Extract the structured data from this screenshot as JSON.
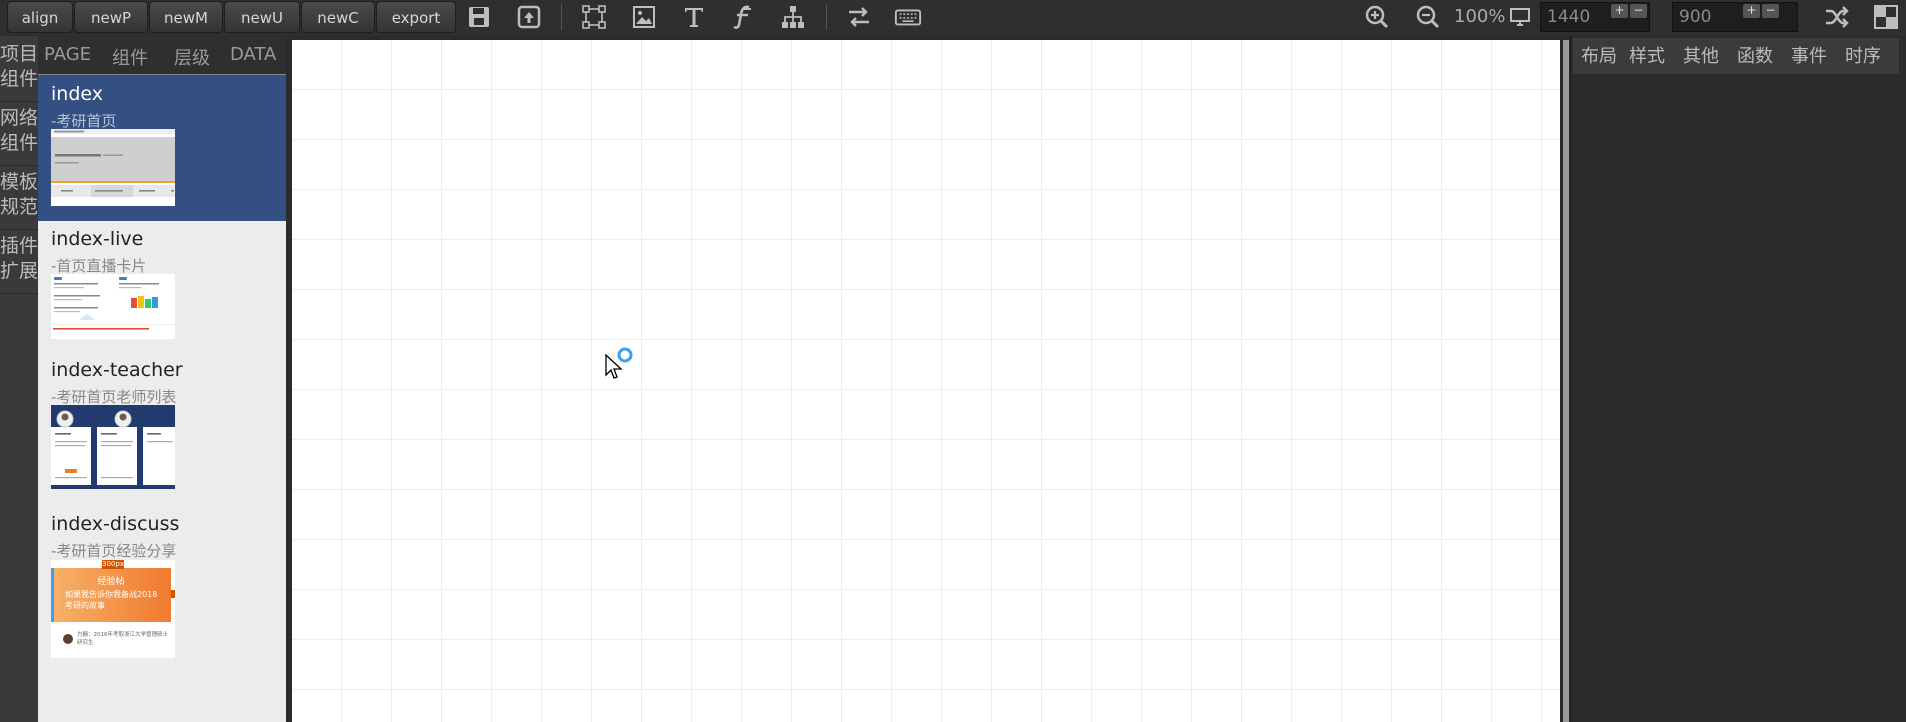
{
  "toolbar": {
    "buttons": [
      "align",
      "newP",
      "newM",
      "newU",
      "newC",
      "export"
    ],
    "icons": [
      "save-icon",
      "upload-icon",
      "select-box-icon",
      "image-icon",
      "text-icon",
      "function-icon",
      "tree-icon",
      "swap-icon",
      "keyboard-icon"
    ],
    "zoom": "100%",
    "width_value": "1440",
    "height_value": "900",
    "plus": "+",
    "minus": "−",
    "right_icons": [
      "zoom-in-icon",
      "zoom-out-icon",
      "monitor-icon",
      "shuffle-icon",
      "layout-icon"
    ]
  },
  "left_tabs": [
    {
      "line1": "项目",
      "line2": "组件"
    },
    {
      "line1": "网络",
      "line2": "组件"
    },
    {
      "line1": "模板",
      "line2": "规范"
    },
    {
      "line1": "插件",
      "line2": "扩展"
    }
  ],
  "page_panel": {
    "tabs": [
      "PAGE",
      "组件",
      "层级",
      "DATA"
    ],
    "pages": [
      {
        "name": "index",
        "desc": "-考研首页"
      },
      {
        "name": "index-live",
        "desc": "-首页直播卡片"
      },
      {
        "name": "index-teacher",
        "desc": "-考研首页老师列表"
      },
      {
        "name": "index-discuss",
        "desc": "-考研首页经验分享"
      }
    ],
    "thumbs": {
      "discuss_badge": "300px",
      "discuss_tag": "经验帖",
      "discuss_title": "如果我告诉你我备战2018考研的故事",
      "discuss_author": "方糖：2016年考取浙江大学管理硕士研究生"
    }
  },
  "right_panel": {
    "tabs": [
      "布局",
      "样式",
      "其他",
      "函数",
      "事件",
      "时序"
    ]
  },
  "colors": {
    "active_page": "#345082",
    "cursor_loader": "#3aa0f2"
  }
}
